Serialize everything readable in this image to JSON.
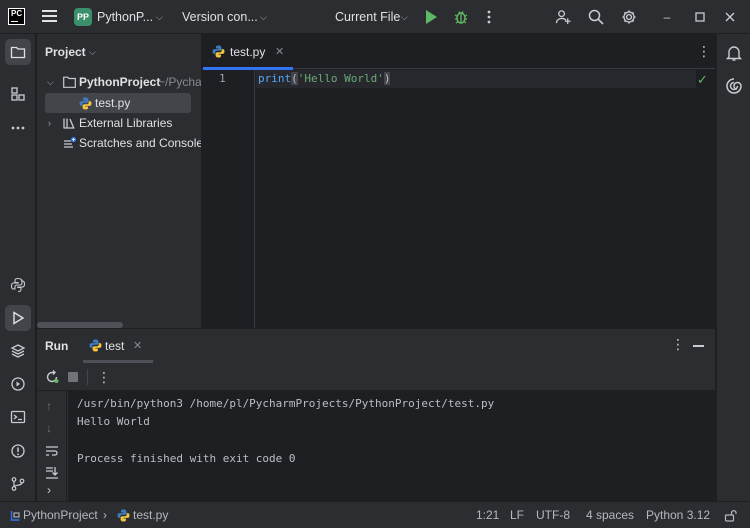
{
  "titlebar": {
    "logo_text": "PC",
    "project_badge": "PP",
    "project_name": "PythonP...",
    "vcs_label": "Version con...",
    "run_config": "Current File"
  },
  "project_panel": {
    "title": "Project",
    "tree": [
      {
        "label": "PythonProject",
        "hint": "~/PycharmProjects/PythonProject"
      },
      {
        "label": "test.py"
      },
      {
        "label": "External Libraries"
      },
      {
        "label": "Scratches and Consoles"
      }
    ]
  },
  "editor": {
    "tab_label": "test.py",
    "line_number": "1",
    "code": {
      "func": "print",
      "open": "(",
      "string": "'Hello World'",
      "close": ")"
    }
  },
  "run_panel": {
    "title": "Run",
    "tab_label": "test",
    "console": [
      "/usr/bin/python3 /home/pl/PycharmProjects/PythonProject/test.py",
      "Hello World",
      "",
      "Process finished with exit code 0"
    ]
  },
  "statusbar": {
    "breadcrumb_project": "PythonProject",
    "breadcrumb_sep": "›",
    "breadcrumb_file": "test.py",
    "position": "1:21",
    "line_ending": "LF",
    "encoding": "UTF-8",
    "indent": "4 spaces",
    "interpreter": "Python 3.12"
  },
  "colors": {
    "accent": "#3574f0",
    "run_green": "#5fb865",
    "debug_green": "#5fb865",
    "badge_green": "#3b8f6a",
    "string_green": "#6aab73",
    "keyword_blue": "#56a8f5"
  }
}
